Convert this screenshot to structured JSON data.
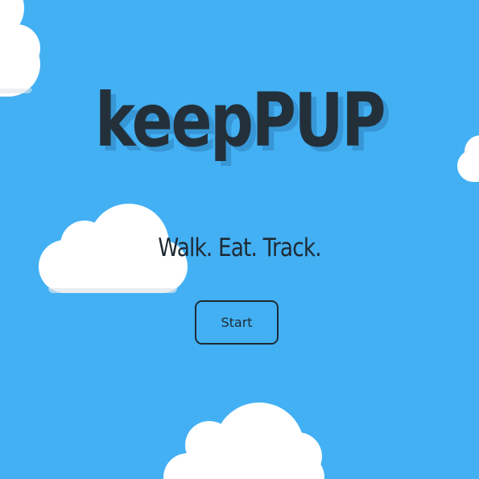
{
  "app": {
    "title": "keepPUP",
    "tagline": "Walk. Eat. Track.",
    "start_label": "Start"
  },
  "colors": {
    "sky": "#43b0f4",
    "text": "#23303a",
    "title_shadow": "#3796d6",
    "cloud": "#ffffff"
  }
}
